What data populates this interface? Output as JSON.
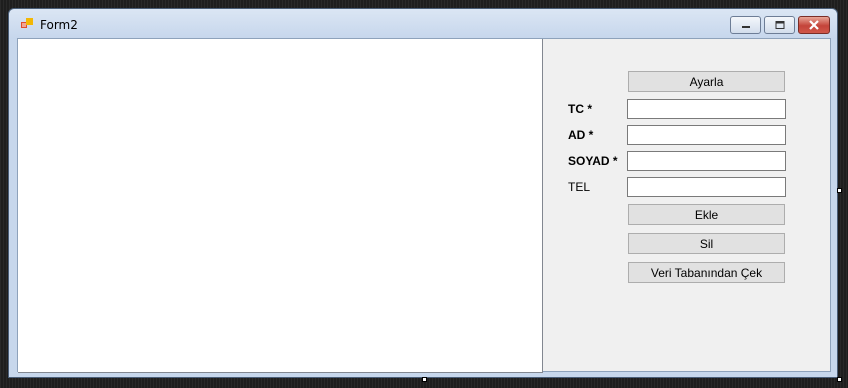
{
  "window": {
    "title": "Form2",
    "icon": "form-app-icon",
    "controls": [
      "minimize-icon",
      "maximize-icon",
      "close-icon"
    ]
  },
  "form": {
    "buttons": {
      "ayarla": "Ayarla",
      "ekle": "Ekle",
      "sil": "Sil",
      "cek": "Veri Tabanından Çek"
    },
    "labels": {
      "tc": "TC *",
      "ad": "AD *",
      "soyad": "SOYAD *",
      "tel": "TEL"
    },
    "fields": {
      "tc": "",
      "ad": "",
      "soyad": "",
      "tel": ""
    }
  },
  "colors": {
    "titlebar": "#c6d6ec",
    "client": "#f0f0f0",
    "close_button": "#c4443a"
  }
}
